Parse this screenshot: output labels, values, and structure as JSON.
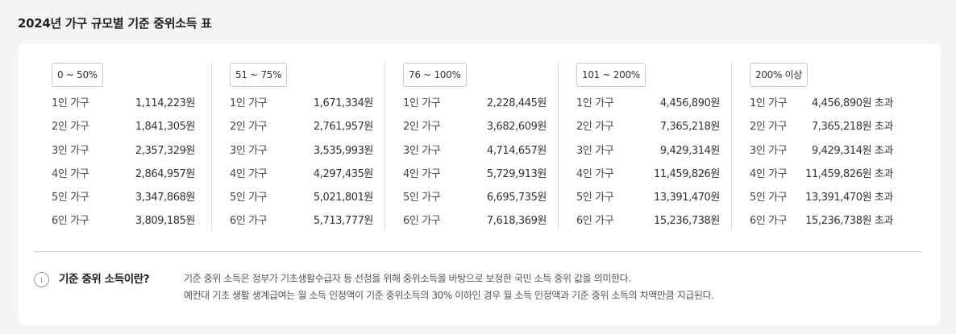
{
  "page": {
    "title": "2024년 가구 규모별 기준 중위소득 표"
  },
  "columns": [
    {
      "range": "0 ~ 50%",
      "rows": [
        {
          "household": "1인 가구",
          "amount": "1,114,223원"
        },
        {
          "household": "2인 가구",
          "amount": "1,841,305원"
        },
        {
          "household": "3인 가구",
          "amount": "2,357,329원"
        },
        {
          "household": "4인 가구",
          "amount": "2,864,957원"
        },
        {
          "household": "5인 가구",
          "amount": "3,347,868원"
        },
        {
          "household": "6인 가구",
          "amount": "3,809,185원"
        }
      ]
    },
    {
      "range": "51 ~ 75%",
      "rows": [
        {
          "household": "1인 가구",
          "amount": "1,671,334원"
        },
        {
          "household": "2인 가구",
          "amount": "2,761,957원"
        },
        {
          "household": "3인 가구",
          "amount": "3,535,993원"
        },
        {
          "household": "4인 가구",
          "amount": "4,297,435원"
        },
        {
          "household": "5인 가구",
          "amount": "5,021,801원"
        },
        {
          "household": "6인 가구",
          "amount": "5,713,777원"
        }
      ]
    },
    {
      "range": "76 ~ 100%",
      "rows": [
        {
          "household": "1인 가구",
          "amount": "2,228,445원"
        },
        {
          "household": "2인 가구",
          "amount": "3,682,609원"
        },
        {
          "household": "3인 가구",
          "amount": "4,714,657원"
        },
        {
          "household": "4인 가구",
          "amount": "5,729,913원"
        },
        {
          "household": "5인 가구",
          "amount": "6,695,735원"
        },
        {
          "household": "6인 가구",
          "amount": "7,618,369원"
        }
      ]
    },
    {
      "range": "101 ~ 200%",
      "rows": [
        {
          "household": "1인 가구",
          "amount": "4,456,890원"
        },
        {
          "household": "2인 가구",
          "amount": "7,365,218원"
        },
        {
          "household": "3인 가구",
          "amount": "9,429,314원"
        },
        {
          "household": "4인 가구",
          "amount": "11,459,826원"
        },
        {
          "household": "5인 가구",
          "amount": "13,391,470원"
        },
        {
          "household": "6인 가구",
          "amount": "15,236,738원"
        }
      ]
    },
    {
      "range": "200% 이상",
      "rows": [
        {
          "household": "1인 가구",
          "amount": "4,456,890원 초과"
        },
        {
          "household": "2인 가구",
          "amount": "7,365,218원 초과"
        },
        {
          "household": "3인 가구",
          "amount": "9,429,314원 초과"
        },
        {
          "household": "4인 가구",
          "amount": "11,459,826원 초과"
        },
        {
          "household": "5인 가구",
          "amount": "13,391,470원 초과"
        },
        {
          "household": "6인 가구",
          "amount": "15,236,738원 초과"
        }
      ]
    }
  ],
  "info": {
    "icon": "i",
    "title": "기준 중위 소득이란?",
    "line1": "기준 중위 소득은 정부가 기초생활수급자 등 선정을 위해 중위소득을 바탕으로 보정한 국민 소득 중위 값을 의미한다.",
    "line2": "예컨대 기초 생활 생계급여는 월 소득 인정액이 기준 중위소득의 30% 이하인 경우 월 소득 인정액과 기준 중위 소득의 차액만큼 지급된다."
  }
}
